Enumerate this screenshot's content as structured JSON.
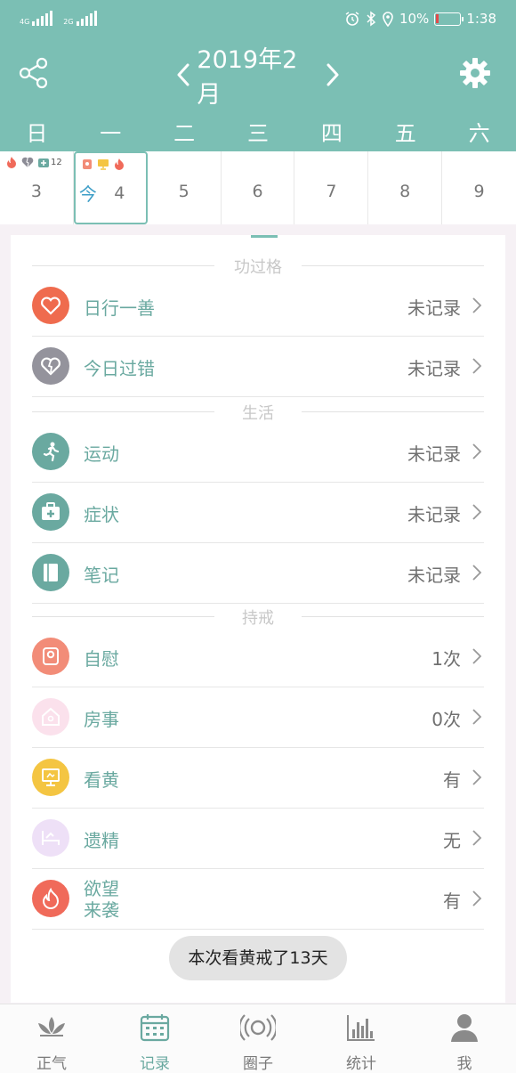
{
  "status": {
    "sig1": "4G",
    "sig2": "2G",
    "battery": "10%",
    "time": "1:38"
  },
  "header": {
    "title": "2019年2月"
  },
  "weekdays": [
    "日",
    "一",
    "二",
    "三",
    "四",
    "五",
    "六"
  ],
  "dates": [
    {
      "num": "3",
      "badge": "12"
    },
    {
      "num": "4",
      "today": "今"
    },
    {
      "num": "5"
    },
    {
      "num": "6"
    },
    {
      "num": "7"
    },
    {
      "num": "8"
    },
    {
      "num": "9"
    }
  ],
  "sections": {
    "merit": "功过格",
    "life": "生活",
    "abstain": "持戒"
  },
  "rows": [
    {
      "label": "日行一善",
      "value": "未记录"
    },
    {
      "label": "今日过错",
      "value": "未记录"
    },
    {
      "label": "运动",
      "value": "未记录"
    },
    {
      "label": "症状",
      "value": "未记录"
    },
    {
      "label": "笔记",
      "value": "未记录"
    },
    {
      "label": "自慰",
      "value": "1次"
    },
    {
      "label": "房事",
      "value": "0次"
    },
    {
      "label": "看黄",
      "value": "有"
    },
    {
      "label": "遗精",
      "value": "无"
    },
    {
      "label1": "欲望",
      "label2": "来袭",
      "value": "有"
    }
  ],
  "toast": "本次看黄戒了13天",
  "tabs": [
    "正气",
    "记录",
    "圈子",
    "统计",
    "我"
  ],
  "colors": {
    "header": "#7bbfb4",
    "accent": "#6aa9a0",
    "today": "#3d9ec7"
  }
}
